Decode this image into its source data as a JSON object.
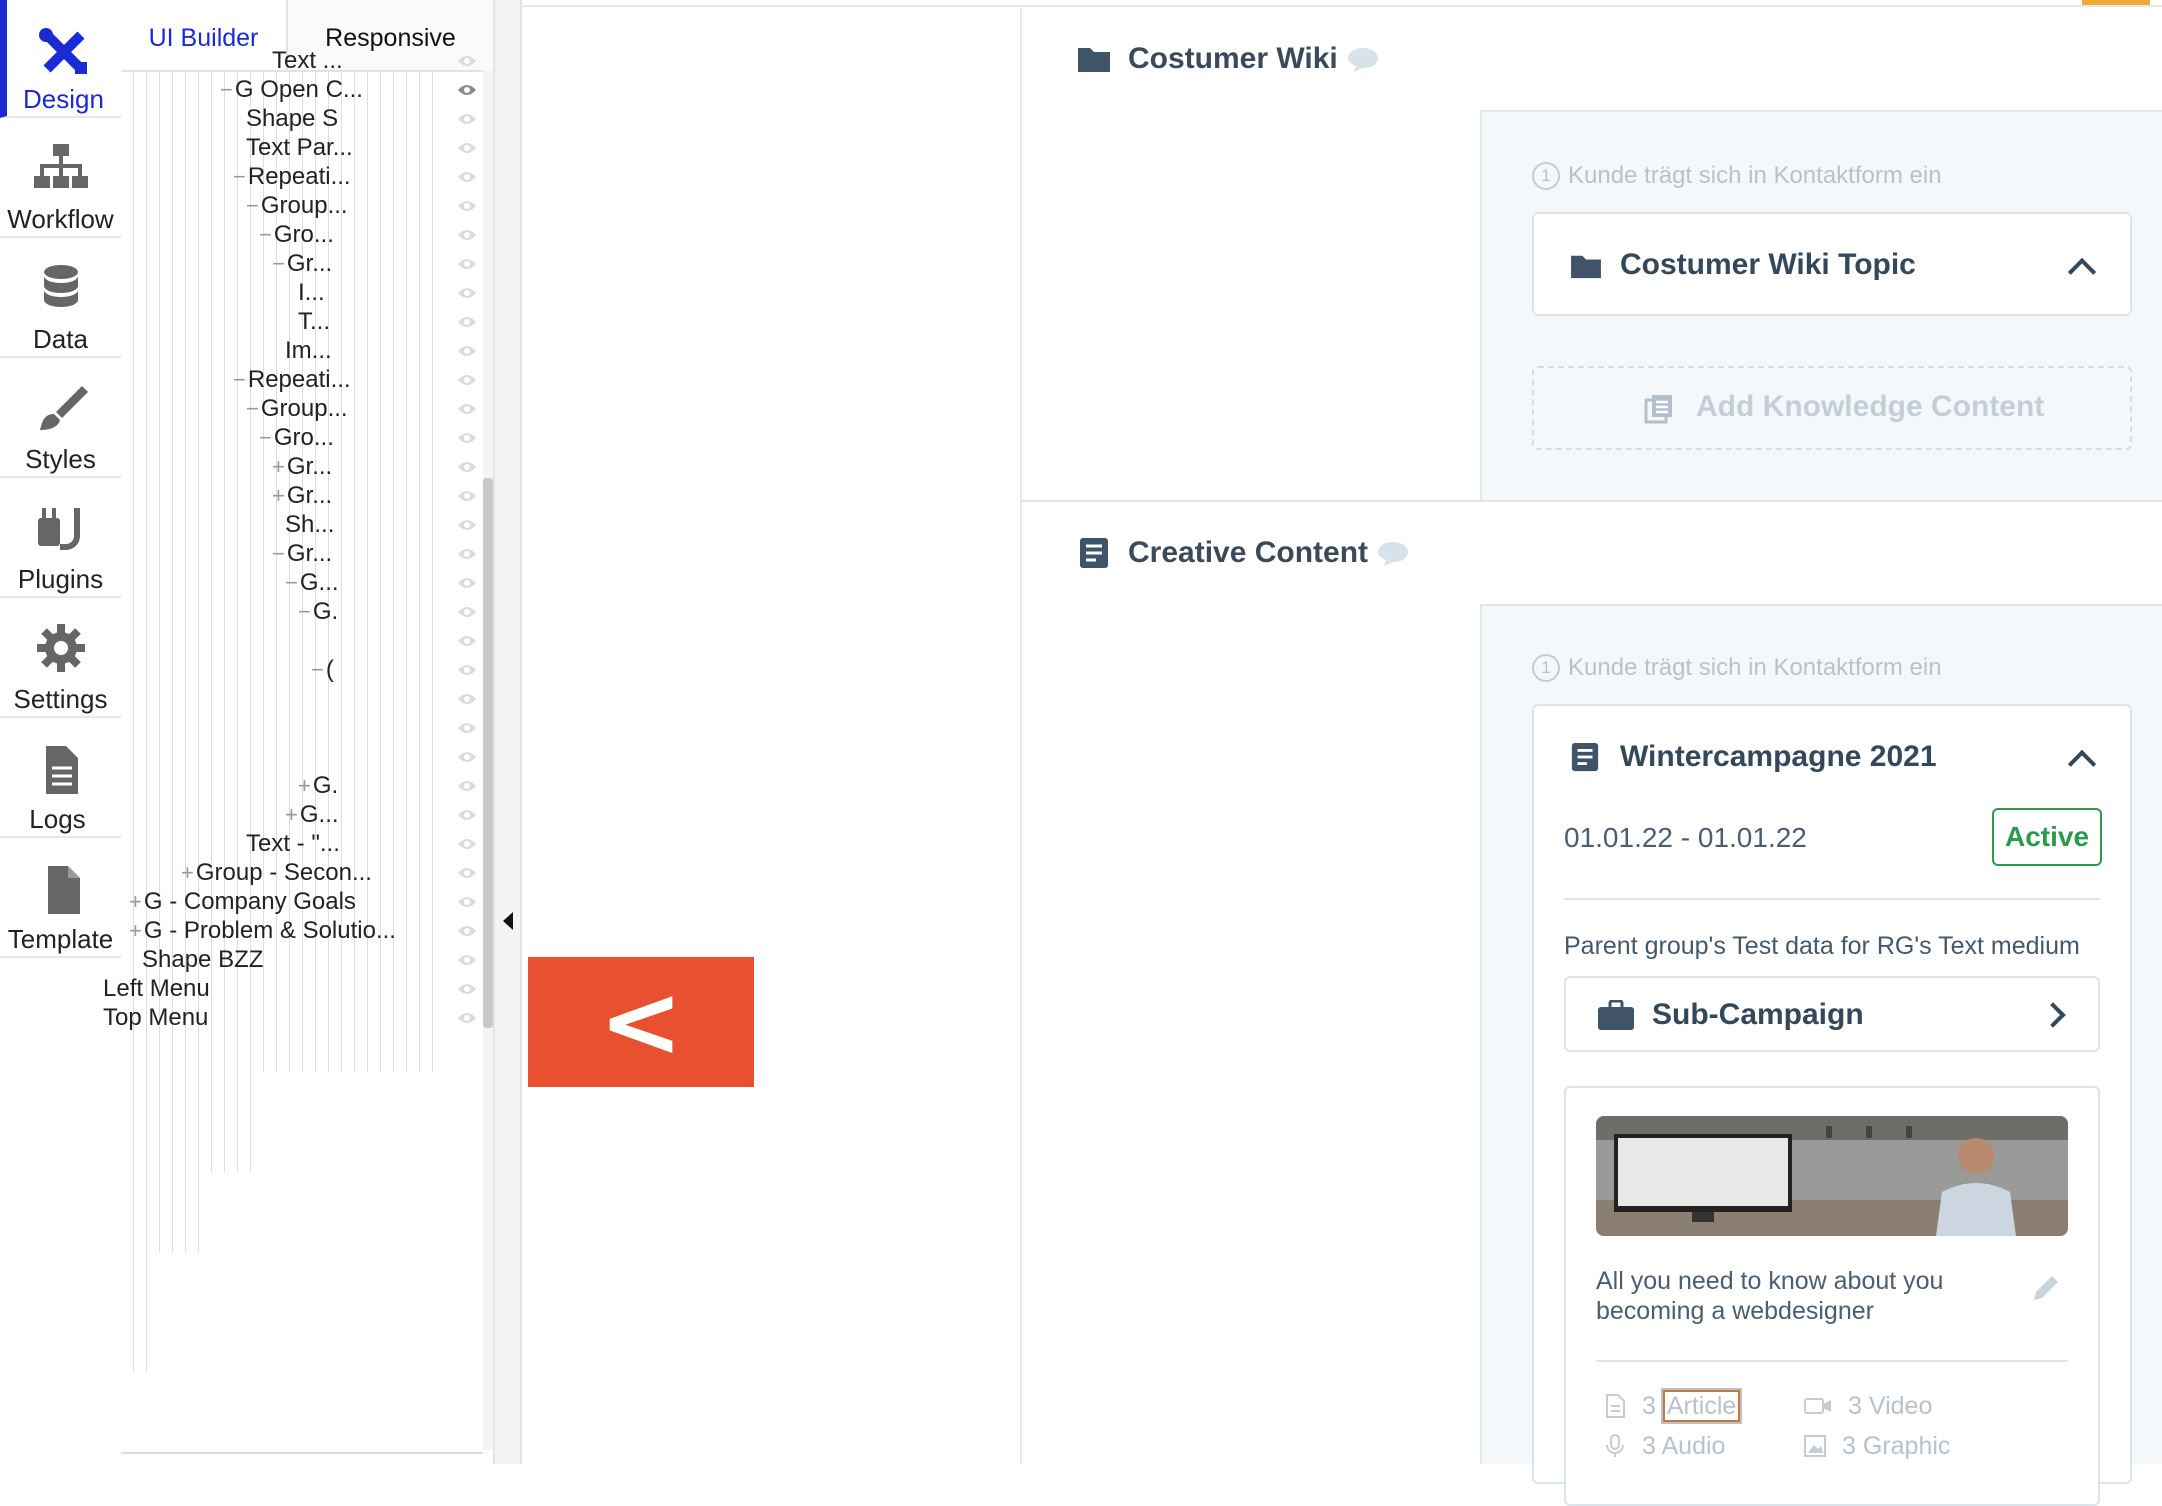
{
  "nav": {
    "items": [
      {
        "key": "design",
        "label": "Design",
        "icon": "design-icon",
        "active": true
      },
      {
        "key": "workflow",
        "label": "Workflow",
        "icon": "workflow-icon",
        "active": false
      },
      {
        "key": "data",
        "label": "Data",
        "icon": "database-icon",
        "active": false
      },
      {
        "key": "styles",
        "label": "Styles",
        "icon": "brush-icon",
        "active": false
      },
      {
        "key": "plugins",
        "label": "Plugins",
        "icon": "plug-icon",
        "active": false
      },
      {
        "key": "settings",
        "label": "Settings",
        "icon": "gear-icon",
        "active": false
      },
      {
        "key": "logs",
        "label": "Logs",
        "icon": "document-icon",
        "active": false
      },
      {
        "key": "template",
        "label": "Template",
        "icon": "template-icon",
        "active": false
      }
    ],
    "accent": "#1a2bd6"
  },
  "tree": {
    "tabs": {
      "ui_builder": "UI Builder",
      "responsive": "Responsive"
    },
    "rows": [
      {
        "toggle": "",
        "label": "Text ..."
      },
      {
        "toggle": "−",
        "label": "G Open C..."
      },
      {
        "toggle": "",
        "label": "Shape S"
      },
      {
        "toggle": "",
        "label": "Text Par..."
      },
      {
        "toggle": "−",
        "label": "Repeati..."
      },
      {
        "toggle": "−",
        "label": "Group..."
      },
      {
        "toggle": "−",
        "label": "Gro..."
      },
      {
        "toggle": "−",
        "label": "Gr..."
      },
      {
        "toggle": "",
        "label": "I..."
      },
      {
        "toggle": "",
        "label": "T..."
      },
      {
        "toggle": "",
        "label": "Im..."
      },
      {
        "toggle": "−",
        "label": "Repeati..."
      },
      {
        "toggle": "−",
        "label": "Group..."
      },
      {
        "toggle": "−",
        "label": "Gro..."
      },
      {
        "toggle": "+",
        "label": "Gr..."
      },
      {
        "toggle": "+",
        "label": "Gr..."
      },
      {
        "toggle": "",
        "label": "Sh..."
      },
      {
        "toggle": "−",
        "label": "Gr..."
      },
      {
        "toggle": "−",
        "label": "G..."
      },
      {
        "toggle": "−",
        "label": "G."
      },
      {
        "toggle": "",
        "label": ""
      },
      {
        "toggle": "−",
        "label": "("
      },
      {
        "toggle": "",
        "label": ""
      },
      {
        "toggle": "",
        "label": ""
      },
      {
        "toggle": "",
        "label": ""
      },
      {
        "toggle": "+",
        "label": "G."
      },
      {
        "toggle": "+",
        "label": "G..."
      },
      {
        "toggle": "",
        "label": "Text - \"..."
      },
      {
        "toggle": "+",
        "label": "Group - Secon..."
      },
      {
        "toggle": "+",
        "label": "G - Company Goals"
      },
      {
        "toggle": "+",
        "label": "G - Problem & Solutio..."
      },
      {
        "toggle": "",
        "label": "Shape BZZ"
      },
      {
        "toggle": "",
        "label": "Left Menu"
      },
      {
        "toggle": "",
        "label": "Top Menu"
      }
    ]
  },
  "annotation": {
    "label": "<—?",
    "color": "#e9502f"
  },
  "sections": {
    "wiki": {
      "title": "Costumer Wiki",
      "step_num": "1",
      "step_text": "Kunde trägt sich in Kontaktform ein",
      "topic_title": "Costumer Wiki Topic",
      "add_label": "Add Knowledge Content"
    },
    "creative": {
      "title": "Creative Content",
      "step_num": "1",
      "step_text": "Kunde trägt sich in Kontaktform ein",
      "campaign": {
        "title": "Wintercampagne 2021",
        "date_range": "01.01.22 - 01.01.22",
        "status": "Active",
        "status_color": "#2b9a4a",
        "description": "Parent group's Test data for RG's Text medium",
        "sub_label": "Sub-Campaign"
      },
      "content": {
        "title": "All you need to know about you becoming a webdesigner",
        "stats": {
          "article_count": "3",
          "article_label": "Article",
          "video_count": "3",
          "video_label": "Video",
          "audio_count": "3",
          "audio_label": "Audio",
          "graphic_count": "3",
          "graphic_label": "Graphic"
        }
      }
    }
  },
  "colors": {
    "heading": "#34485c",
    "muted": "#b8c2cc",
    "panel": "#f5f8fa"
  }
}
